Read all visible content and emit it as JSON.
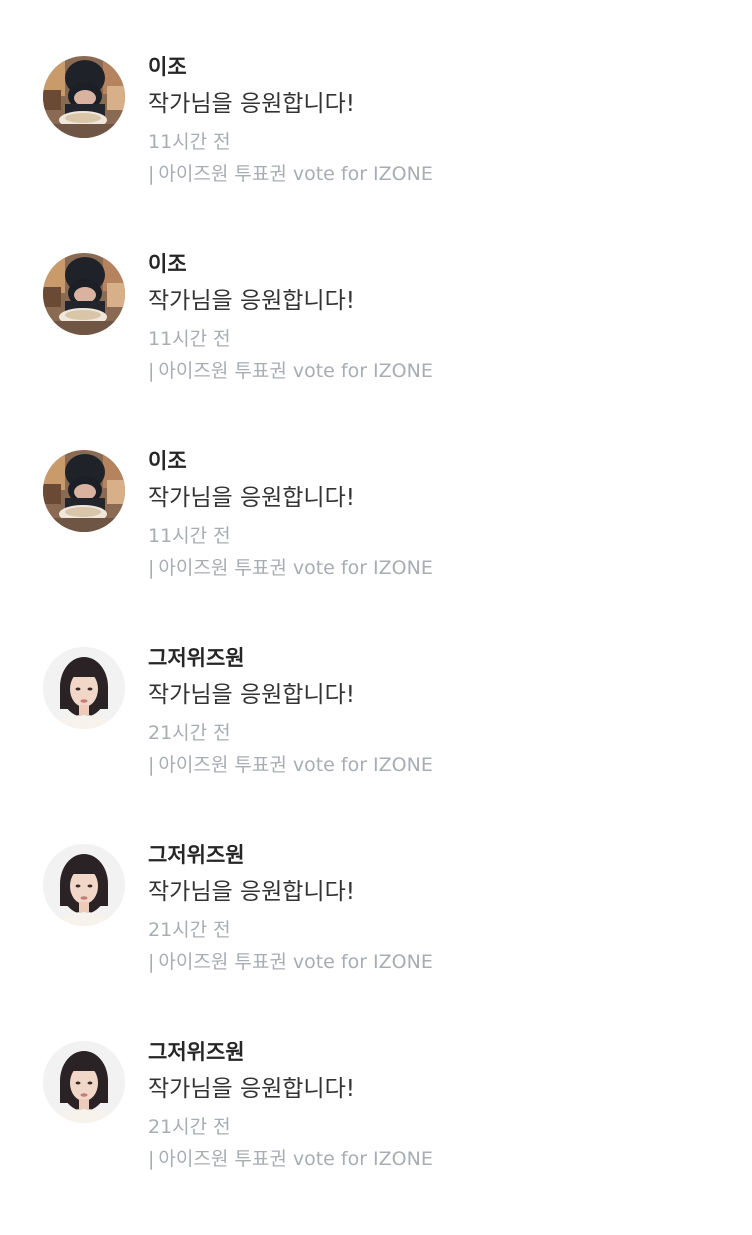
{
  "comments": [
    {
      "name": "이조",
      "message": "작가님을 응원합니다!",
      "time": "11시간 전",
      "source_prefix": "|",
      "source": "아이즈원 투표권 vote for IZONE",
      "avatar": "child-eating-photo"
    },
    {
      "name": "이조",
      "message": "작가님을 응원합니다!",
      "time": "11시간 전",
      "source_prefix": "|",
      "source": "아이즈원 투표권 vote for IZONE",
      "avatar": "child-eating-photo"
    },
    {
      "name": "이조",
      "message": "작가님을 응원합니다!",
      "time": "11시간 전",
      "source_prefix": "|",
      "source": "아이즈원 투표권 vote for IZONE",
      "avatar": "child-eating-photo"
    },
    {
      "name": "그저위즈원",
      "message": "작가님을 응원합니다!",
      "time": "21시간 전",
      "source_prefix": "|",
      "source": "아이즈원 투표권 vote for IZONE",
      "avatar": "woman-portrait-photo"
    },
    {
      "name": "그저위즈원",
      "message": "작가님을 응원합니다!",
      "time": "21시간 전",
      "source_prefix": "|",
      "source": "아이즈원 투표권 vote for IZONE",
      "avatar": "woman-portrait-photo"
    },
    {
      "name": "그저위즈원",
      "message": "작가님을 응원합니다!",
      "time": "21시간 전",
      "source_prefix": "|",
      "source": "아이즈원 투표권 vote for IZONE",
      "avatar": "woman-portrait-photo"
    }
  ],
  "colors": {
    "name": "#262626",
    "message": "#333333",
    "meta": "#a8adb3",
    "background": "#ffffff"
  }
}
